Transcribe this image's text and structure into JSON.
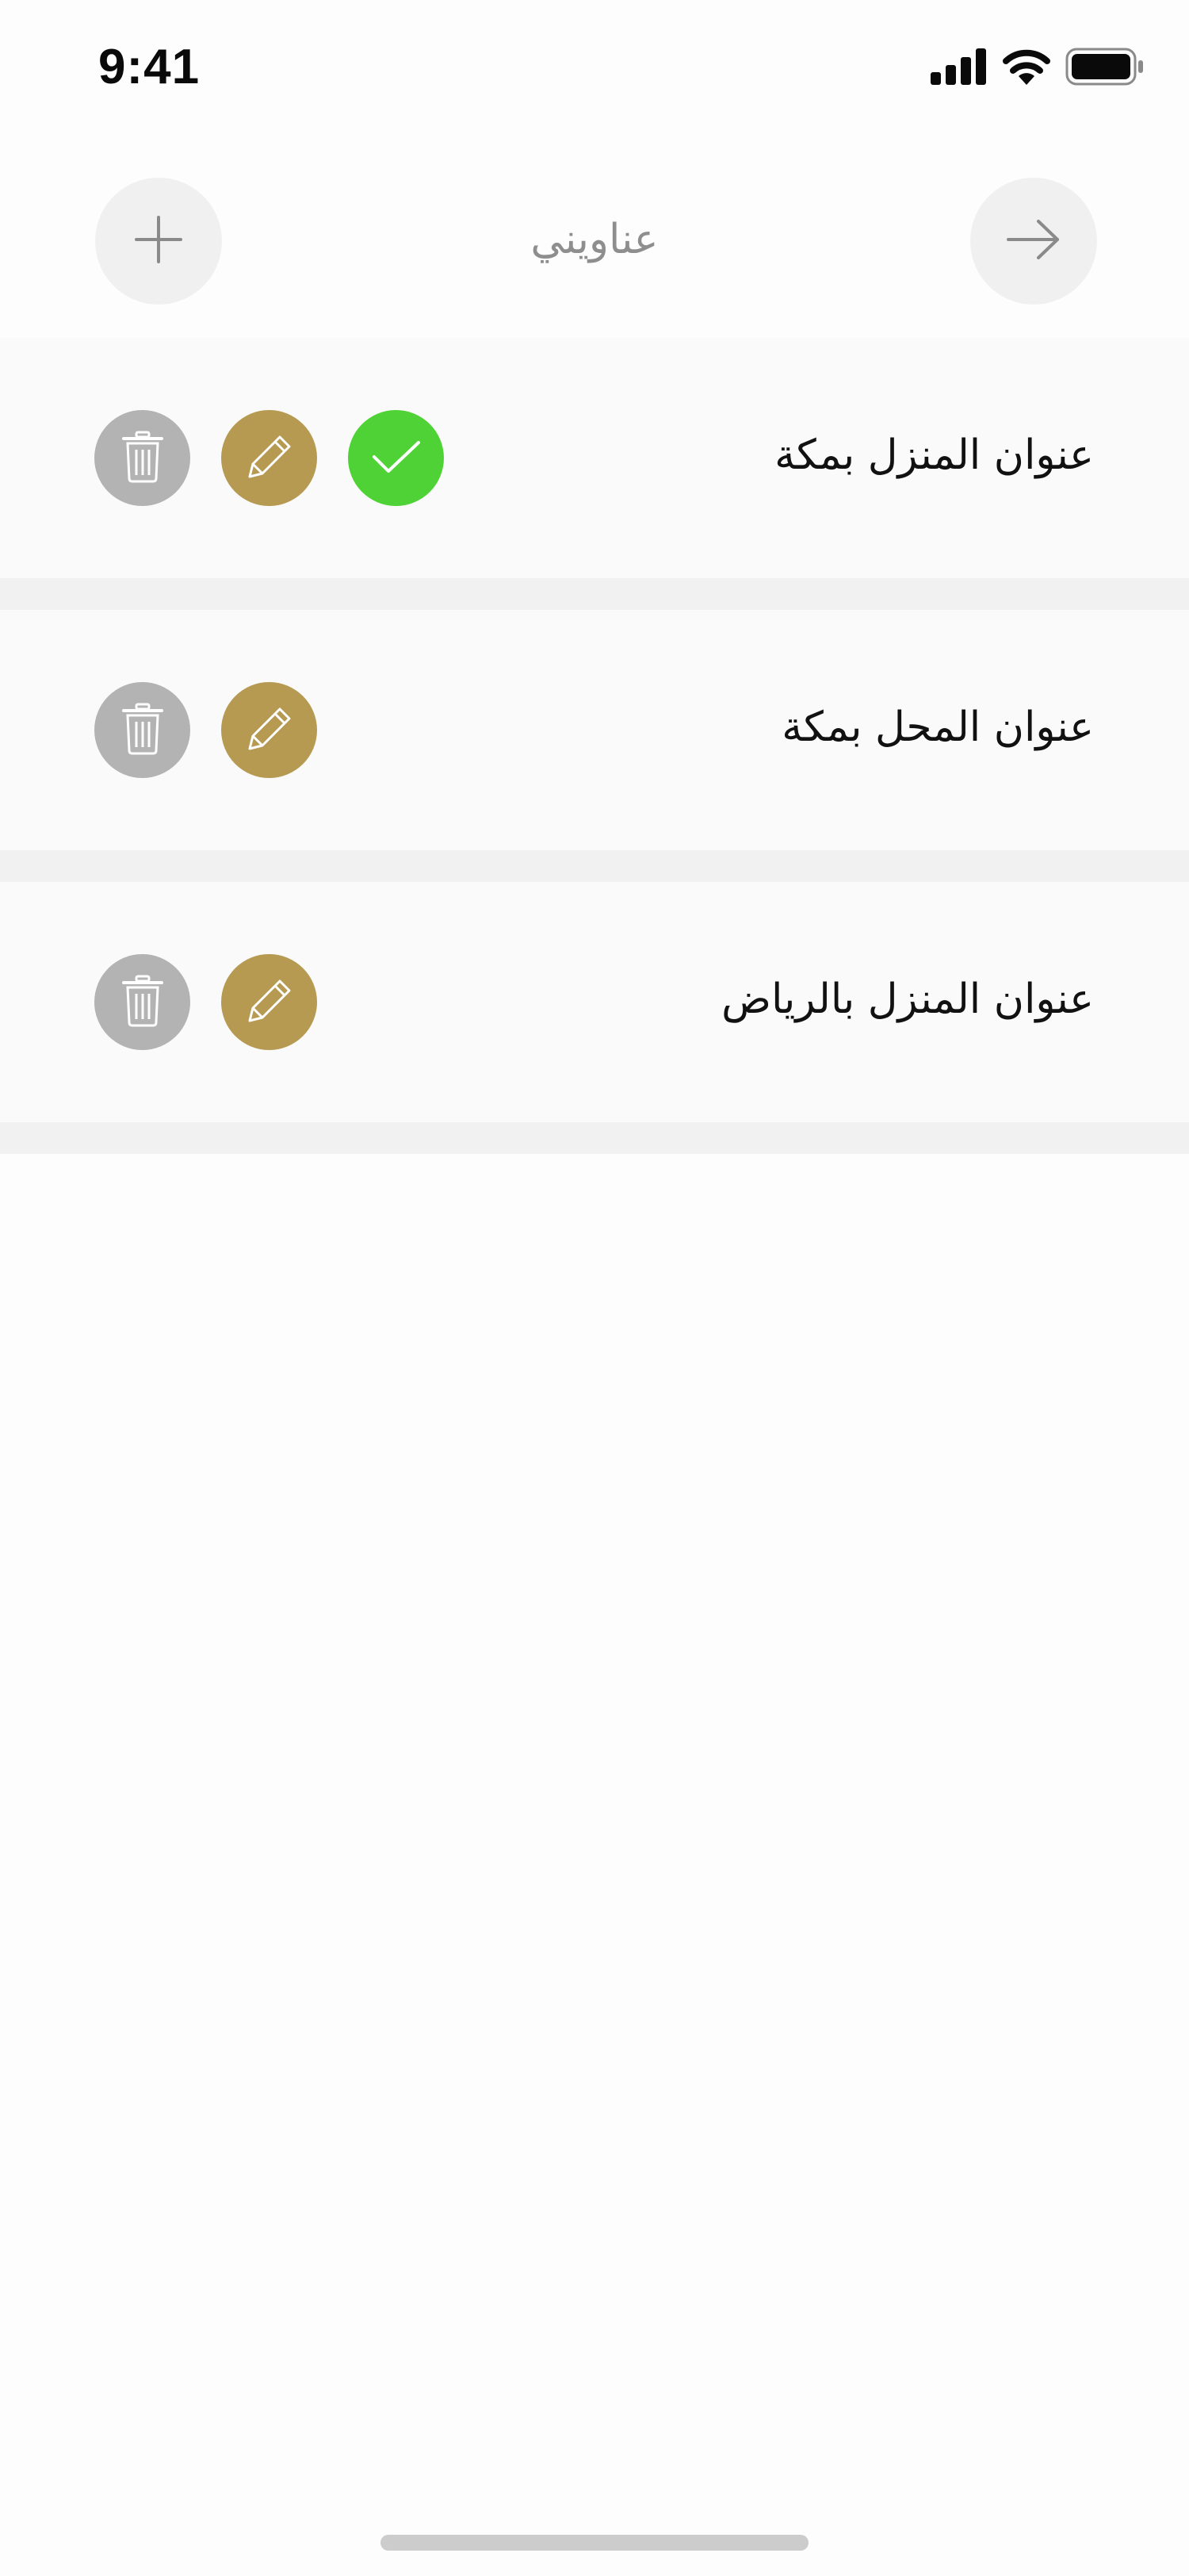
{
  "status_bar": {
    "time": "9:41",
    "icons": [
      "cellular-signal-icon",
      "wifi-icon",
      "battery-icon"
    ]
  },
  "header": {
    "title": "عناويني",
    "add_icon": "plus-icon",
    "back_icon": "arrow-right-icon"
  },
  "addresses": [
    {
      "name": "عنوان المنزل بمكة",
      "selected": true
    },
    {
      "name": "عنوان المحل بمكة",
      "selected": false
    },
    {
      "name": "عنوان المنزل بالرياض",
      "selected": false
    }
  ],
  "colors": {
    "edit": "#b69a52",
    "delete": "#b3b3b3",
    "selected": "#4fd236",
    "title": "#8e8e8e",
    "row_background": "#fafafa",
    "separator": "#f1f1f1"
  }
}
